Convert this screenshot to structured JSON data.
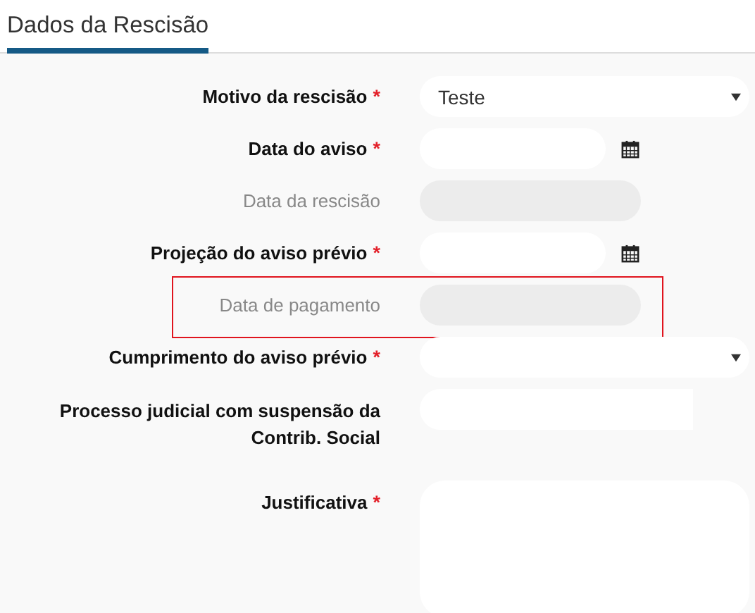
{
  "section": {
    "title": "Dados da Rescisão"
  },
  "fields": [
    {
      "label": "Motivo da rescisão",
      "kind": "select",
      "required": true,
      "disabled": false,
      "highlighted": false,
      "value": "Teste"
    },
    {
      "label": "Data do aviso",
      "kind": "date",
      "required": true,
      "disabled": false,
      "highlighted": false
    },
    {
      "label": "Data da rescisão",
      "kind": "date",
      "required": false,
      "disabled": true,
      "highlighted": false
    },
    {
      "label": "Projeção do aviso prévio",
      "kind": "date",
      "required": true,
      "disabled": false,
      "highlighted": false
    },
    {
      "label": "Data de pagamento",
      "kind": "date",
      "required": false,
      "disabled": true,
      "highlighted": true
    },
    {
      "label": "Cumprimento do aviso prévio",
      "kind": "select",
      "required": true,
      "disabled": false,
      "highlighted": false
    },
    {
      "label": "Processo judicial com suspensão da Contrib. Social",
      "kind": "text",
      "required": false,
      "disabled": false,
      "highlighted": false
    },
    {
      "label": "Justificativa",
      "kind": "textarea",
      "required": true,
      "disabled": false,
      "highlighted": false
    }
  ],
  "required_mark": "*"
}
